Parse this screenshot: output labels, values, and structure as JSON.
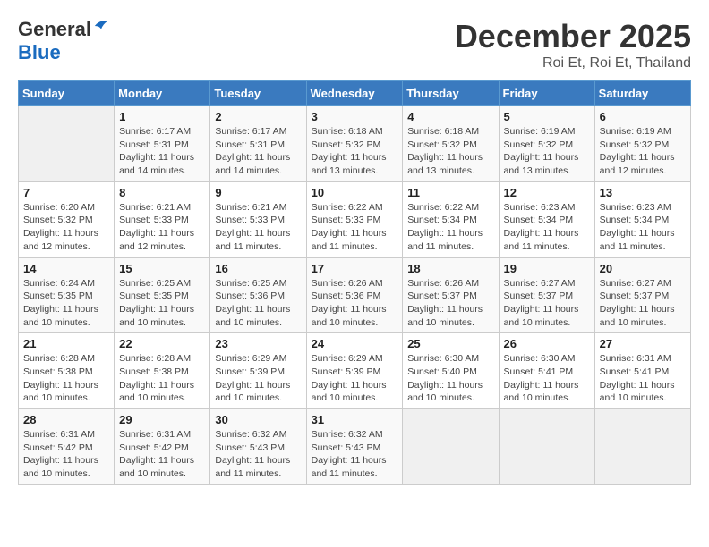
{
  "header": {
    "logo_general": "General",
    "logo_blue": "Blue",
    "month": "December 2025",
    "location": "Roi Et, Roi Et, Thailand"
  },
  "weekdays": [
    "Sunday",
    "Monday",
    "Tuesday",
    "Wednesday",
    "Thursday",
    "Friday",
    "Saturday"
  ],
  "weeks": [
    [
      {
        "day": "",
        "info": ""
      },
      {
        "day": "1",
        "info": "Sunrise: 6:17 AM\nSunset: 5:31 PM\nDaylight: 11 hours\nand 14 minutes."
      },
      {
        "day": "2",
        "info": "Sunrise: 6:17 AM\nSunset: 5:31 PM\nDaylight: 11 hours\nand 14 minutes."
      },
      {
        "day": "3",
        "info": "Sunrise: 6:18 AM\nSunset: 5:32 PM\nDaylight: 11 hours\nand 13 minutes."
      },
      {
        "day": "4",
        "info": "Sunrise: 6:18 AM\nSunset: 5:32 PM\nDaylight: 11 hours\nand 13 minutes."
      },
      {
        "day": "5",
        "info": "Sunrise: 6:19 AM\nSunset: 5:32 PM\nDaylight: 11 hours\nand 13 minutes."
      },
      {
        "day": "6",
        "info": "Sunrise: 6:19 AM\nSunset: 5:32 PM\nDaylight: 11 hours\nand 12 minutes."
      }
    ],
    [
      {
        "day": "7",
        "info": "Sunrise: 6:20 AM\nSunset: 5:32 PM\nDaylight: 11 hours\nand 12 minutes."
      },
      {
        "day": "8",
        "info": "Sunrise: 6:21 AM\nSunset: 5:33 PM\nDaylight: 11 hours\nand 12 minutes."
      },
      {
        "day": "9",
        "info": "Sunrise: 6:21 AM\nSunset: 5:33 PM\nDaylight: 11 hours\nand 11 minutes."
      },
      {
        "day": "10",
        "info": "Sunrise: 6:22 AM\nSunset: 5:33 PM\nDaylight: 11 hours\nand 11 minutes."
      },
      {
        "day": "11",
        "info": "Sunrise: 6:22 AM\nSunset: 5:34 PM\nDaylight: 11 hours\nand 11 minutes."
      },
      {
        "day": "12",
        "info": "Sunrise: 6:23 AM\nSunset: 5:34 PM\nDaylight: 11 hours\nand 11 minutes."
      },
      {
        "day": "13",
        "info": "Sunrise: 6:23 AM\nSunset: 5:34 PM\nDaylight: 11 hours\nand 11 minutes."
      }
    ],
    [
      {
        "day": "14",
        "info": "Sunrise: 6:24 AM\nSunset: 5:35 PM\nDaylight: 11 hours\nand 10 minutes."
      },
      {
        "day": "15",
        "info": "Sunrise: 6:25 AM\nSunset: 5:35 PM\nDaylight: 11 hours\nand 10 minutes."
      },
      {
        "day": "16",
        "info": "Sunrise: 6:25 AM\nSunset: 5:36 PM\nDaylight: 11 hours\nand 10 minutes."
      },
      {
        "day": "17",
        "info": "Sunrise: 6:26 AM\nSunset: 5:36 PM\nDaylight: 11 hours\nand 10 minutes."
      },
      {
        "day": "18",
        "info": "Sunrise: 6:26 AM\nSunset: 5:37 PM\nDaylight: 11 hours\nand 10 minutes."
      },
      {
        "day": "19",
        "info": "Sunrise: 6:27 AM\nSunset: 5:37 PM\nDaylight: 11 hours\nand 10 minutes."
      },
      {
        "day": "20",
        "info": "Sunrise: 6:27 AM\nSunset: 5:37 PM\nDaylight: 11 hours\nand 10 minutes."
      }
    ],
    [
      {
        "day": "21",
        "info": "Sunrise: 6:28 AM\nSunset: 5:38 PM\nDaylight: 11 hours\nand 10 minutes."
      },
      {
        "day": "22",
        "info": "Sunrise: 6:28 AM\nSunset: 5:38 PM\nDaylight: 11 hours\nand 10 minutes."
      },
      {
        "day": "23",
        "info": "Sunrise: 6:29 AM\nSunset: 5:39 PM\nDaylight: 11 hours\nand 10 minutes."
      },
      {
        "day": "24",
        "info": "Sunrise: 6:29 AM\nSunset: 5:39 PM\nDaylight: 11 hours\nand 10 minutes."
      },
      {
        "day": "25",
        "info": "Sunrise: 6:30 AM\nSunset: 5:40 PM\nDaylight: 11 hours\nand 10 minutes."
      },
      {
        "day": "26",
        "info": "Sunrise: 6:30 AM\nSunset: 5:41 PM\nDaylight: 11 hours\nand 10 minutes."
      },
      {
        "day": "27",
        "info": "Sunrise: 6:31 AM\nSunset: 5:41 PM\nDaylight: 11 hours\nand 10 minutes."
      }
    ],
    [
      {
        "day": "28",
        "info": "Sunrise: 6:31 AM\nSunset: 5:42 PM\nDaylight: 11 hours\nand 10 minutes."
      },
      {
        "day": "29",
        "info": "Sunrise: 6:31 AM\nSunset: 5:42 PM\nDaylight: 11 hours\nand 10 minutes."
      },
      {
        "day": "30",
        "info": "Sunrise: 6:32 AM\nSunset: 5:43 PM\nDaylight: 11 hours\nand 11 minutes."
      },
      {
        "day": "31",
        "info": "Sunrise: 6:32 AM\nSunset: 5:43 PM\nDaylight: 11 hours\nand 11 minutes."
      },
      {
        "day": "",
        "info": ""
      },
      {
        "day": "",
        "info": ""
      },
      {
        "day": "",
        "info": ""
      }
    ]
  ]
}
